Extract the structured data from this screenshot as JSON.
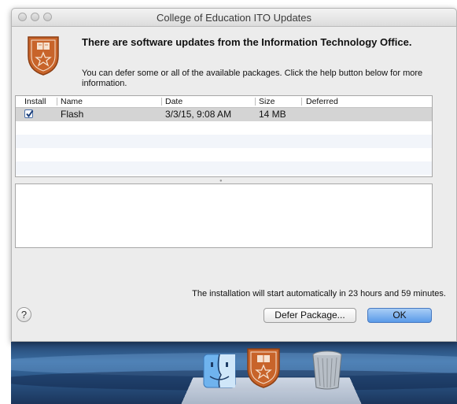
{
  "window": {
    "title": "College of Education ITO Updates"
  },
  "message": {
    "headline": "There are software updates from the Information Technology Office.",
    "body": "You can defer some or all of the available packages. Click the help button below for more information."
  },
  "table": {
    "columns": [
      "Install",
      "Name",
      "Date",
      "Size",
      "Deferred"
    ],
    "rows": [
      {
        "install": true,
        "name": "Flash",
        "date": "3/3/15, 9:08 AM",
        "size": "14 MB",
        "deferred": ""
      }
    ]
  },
  "status_text": "The installation will start automatically in 23 hours and 59 minutes.",
  "buttons": {
    "help": "?",
    "defer": "Defer Package...",
    "ok": "OK"
  },
  "colors": {
    "accent": "#5a9ae8",
    "selected_row": "#d4d4d4",
    "logo": "#c8642a"
  },
  "icons": [
    "close-icon",
    "minimize-icon",
    "zoom-icon",
    "ut-shield-logo",
    "checkmark-icon",
    "help-icon",
    "finder-icon",
    "trash-icon"
  ]
}
